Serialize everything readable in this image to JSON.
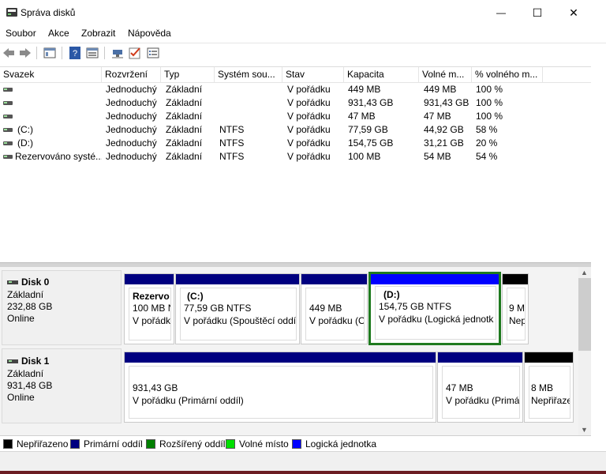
{
  "window": {
    "title": "Správa disků",
    "minimize_glyph": "—",
    "maximize_glyph": "☐",
    "close_glyph": "✕"
  },
  "menu": [
    "Soubor",
    "Akce",
    "Zobrazit",
    "Nápověda"
  ],
  "toolbar_icons": [
    "back-arrow-icon",
    "forward-arrow-icon",
    "console-tree-icon",
    "help-icon",
    "properties-icon",
    "connect-icon",
    "check-icon",
    "list-view-icon"
  ],
  "volume_table": {
    "headers": [
      "Svazek",
      "Rozvržení",
      "Typ",
      "Systém sou...",
      "Stav",
      "Kapacita",
      "Volné m...",
      "% volného m..."
    ],
    "rows": [
      {
        "name": "",
        "layout": "Jednoduchý",
        "type": "Základní",
        "fs": "",
        "status": "V pořádku",
        "capacity": "449 MB",
        "free": "449 MB",
        "pct": "100 %"
      },
      {
        "name": "",
        "layout": "Jednoduchý",
        "type": "Základní",
        "fs": "",
        "status": "V pořádku",
        "capacity": "931,43 GB",
        "free": "931,43 GB",
        "pct": "100 %"
      },
      {
        "name": "",
        "layout": "Jednoduchý",
        "type": "Základní",
        "fs": "",
        "status": "V pořádku",
        "capacity": "47 MB",
        "free": "47 MB",
        "pct": "100 %"
      },
      {
        "name": "(C:)",
        "layout": "Jednoduchý",
        "type": "Základní",
        "fs": "NTFS",
        "status": "V pořádku",
        "capacity": "77,59 GB",
        "free": "44,92 GB",
        "pct": "58 %"
      },
      {
        "name": "(D:)",
        "layout": "Jednoduchý",
        "type": "Základní",
        "fs": "NTFS",
        "status": "V pořádku",
        "capacity": "154,75 GB",
        "free": "31,21 GB",
        "pct": "20 %"
      },
      {
        "name": "Rezervováno systé...",
        "layout": "Jednoduchý",
        "type": "Základní",
        "fs": "NTFS",
        "status": "V pořádku",
        "capacity": "100 MB",
        "free": "54 MB",
        "pct": "54 %"
      }
    ]
  },
  "disks": [
    {
      "name": "Disk 0",
      "type": "Základní",
      "size": "232,88 GB",
      "state": "Online",
      "partitions": [
        {
          "title": "Rezervo",
          "line1": "100 MB N",
          "line2": "V pořádk"
        },
        {
          "title": "(C:)",
          "line1": "77,59 GB NTFS",
          "line2": "V pořádku (Spouštěcí oddíl,"
        },
        {
          "title": "",
          "line1": "449 MB",
          "line2": "V pořádku (O"
        },
        {
          "title": "(D:)",
          "line1": "154,75 GB NTFS",
          "line2": "V pořádku (Logická jednotk"
        },
        {
          "title": "",
          "line1": "9 M",
          "line2": "Nep"
        }
      ]
    },
    {
      "name": "Disk 1",
      "type": "Základní",
      "size": "931,48 GB",
      "state": "Online",
      "partitions": [
        {
          "line1": "931,43 GB",
          "line2": "V pořádku (Primární oddíl)"
        },
        {
          "line1": "47 MB",
          "line2": "V pořádku (Primár"
        },
        {
          "line1": "8 MB",
          "line2": "Nepřiřaze"
        }
      ]
    }
  ],
  "legend": [
    {
      "label": "Nepřiřazeno",
      "color": "#000000"
    },
    {
      "label": "Primární oddíl",
      "color": "#000080"
    },
    {
      "label": "Rozšířený oddíl",
      "color": "#008000"
    },
    {
      "label": "Volné místo",
      "color": "#00e000"
    },
    {
      "label": "Logická jednotka",
      "color": "#0000ff"
    }
  ],
  "colors": {
    "primary": "#000080",
    "logical": "#0000ff",
    "unallocated": "#000000",
    "selected_border": "#1f7a1f"
  }
}
